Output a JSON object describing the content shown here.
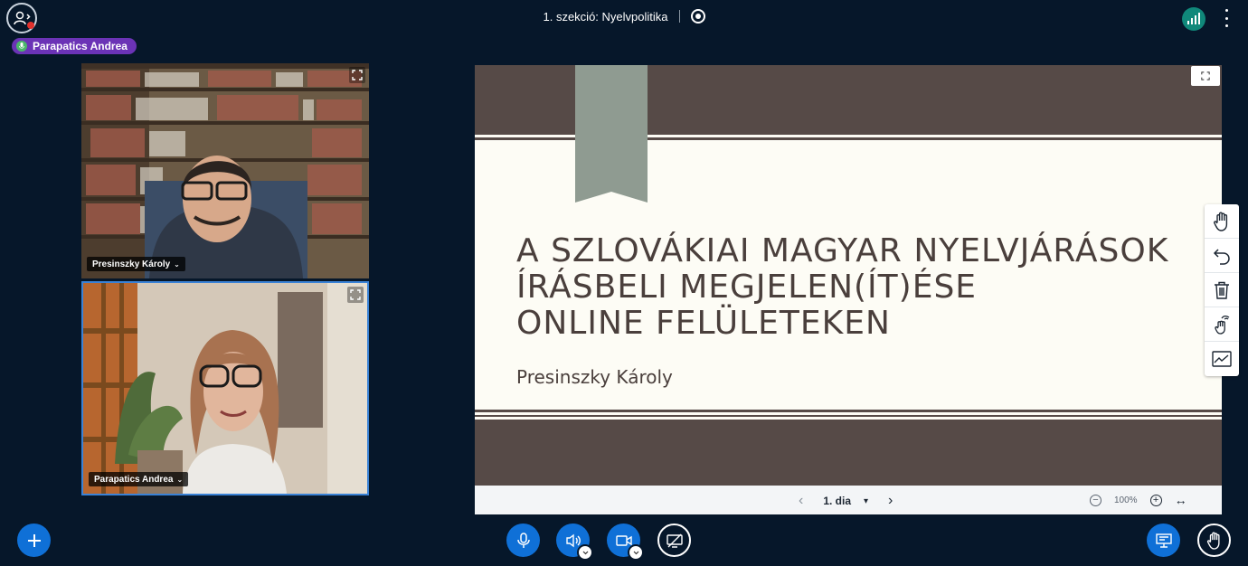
{
  "header": {
    "session_title": "1. szekció: Nyelvpolitika",
    "talking_indicator": "Parapatics Andrea"
  },
  "webcams": [
    {
      "name": "Presinszky Károly"
    },
    {
      "name": "Parapatics Andrea"
    }
  ],
  "slide": {
    "title_lines": [
      "A SZLOVÁKIAI MAGYAR NYELVJÁRÁSOK",
      "ÍRÁSBELI MEGJELEN(ÍT)ÉSE",
      "ONLINE FELÜLETEKEN"
    ],
    "author": "Presinszky Károly"
  },
  "presentation_toolbar": {
    "slide_select": "1. dia",
    "zoom": "100%"
  },
  "whiteboard_tools": [
    "hand-icon",
    "undo-icon",
    "trash-icon",
    "multi-user-icon",
    "line-chart-icon"
  ],
  "colors": {
    "background": "#06172a",
    "primary": "#0f70d7",
    "talker_badge": "#6b33b6",
    "connection": "#10887a",
    "slide_band": "#564a47",
    "ribbon": "#8f9b91"
  }
}
